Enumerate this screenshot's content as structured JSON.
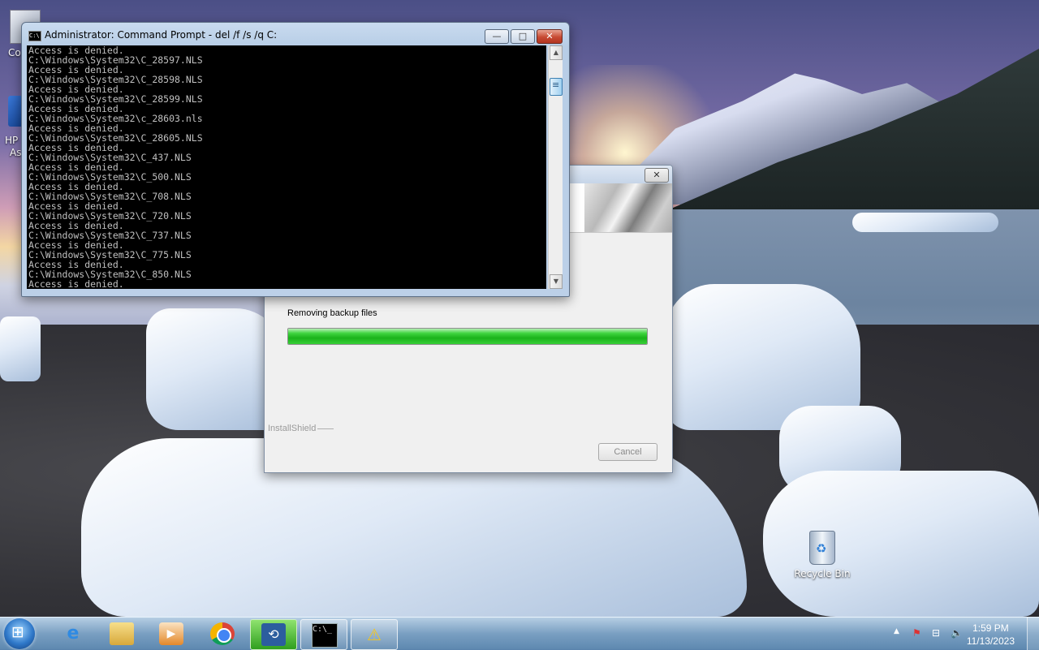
{
  "desktop": {
    "recycle_bin_label": "Recycle Bin",
    "partial_icon_labels": [
      "Co",
      "HP",
      "As"
    ]
  },
  "cmd_window": {
    "title": "Administrator:  Command Prompt - del  /f /s /q C:",
    "buttons": {
      "minimize": "—",
      "maximize": "□",
      "close": "✕"
    },
    "lines": [
      "Access is denied.",
      "C:\\Windows\\System32\\C_28597.NLS",
      "Access is denied.",
      "C:\\Windows\\System32\\C_28598.NLS",
      "Access is denied.",
      "C:\\Windows\\System32\\C_28599.NLS",
      "Access is denied.",
      "C:\\Windows\\System32\\c_28603.nls",
      "Access is denied.",
      "C:\\Windows\\System32\\C_28605.NLS",
      "Access is denied.",
      "C:\\Windows\\System32\\C_437.NLS",
      "Access is denied.",
      "C:\\Windows\\System32\\C_500.NLS",
      "Access is denied.",
      "C:\\Windows\\System32\\C_708.NLS",
      "Access is denied.",
      "C:\\Windows\\System32\\C_720.NLS",
      "Access is denied.",
      "C:\\Windows\\System32\\C_737.NLS",
      "Access is denied.",
      "C:\\Windows\\System32\\C_775.NLS",
      "Access is denied.",
      "C:\\Windows\\System32\\C_850.NLS",
      "Access is denied."
    ],
    "scroll_up": "▲",
    "scroll_down": "▼"
  },
  "installshield": {
    "close": "✕",
    "status": "Removing backup files",
    "progress": 1.0,
    "brand": "InstallShield",
    "cancel_label": "Cancel"
  },
  "taskbar": {
    "items": [
      {
        "name": "Internet Explorer",
        "glyph": "e"
      },
      {
        "name": "Windows Explorer",
        "glyph": ""
      },
      {
        "name": "Windows Media Player",
        "glyph": "▶"
      },
      {
        "name": "Google Chrome",
        "glyph": ""
      },
      {
        "name": "Setup",
        "glyph": "⟲"
      },
      {
        "name": "Command Prompt",
        "glyph": "C:\\_"
      },
      {
        "name": "Action Center",
        "glyph": "⚠"
      }
    ],
    "tray": {
      "arrow": "▲",
      "flag": "⚑",
      "network": "⊟",
      "volume": "🔈"
    },
    "clock": {
      "time": "1:59 PM",
      "date": "11/13/2023"
    }
  }
}
